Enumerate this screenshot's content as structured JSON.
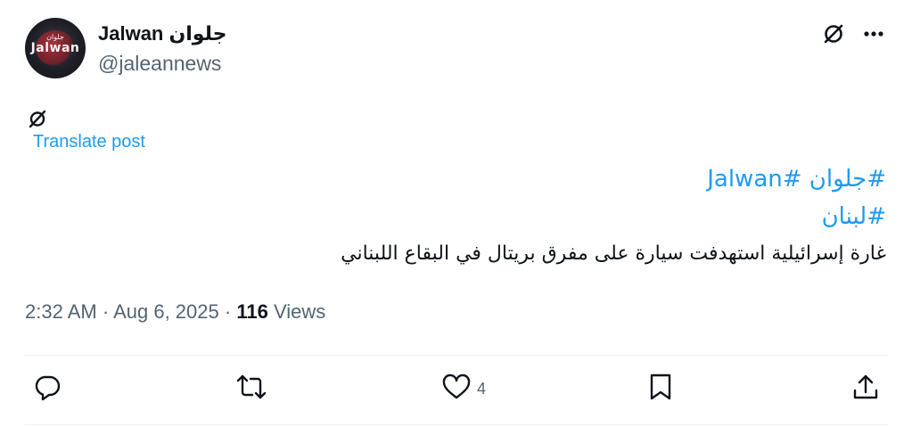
{
  "author": {
    "display_name": "Jalwan جلوان",
    "handle": "@jaleannews",
    "avatar_text": "Jalwan",
    "avatar_subtext": "جلوان"
  },
  "header": {
    "grok_icon": "grok-slash-icon",
    "more_icon": "more-dots-icon"
  },
  "post": {
    "translate_label": "Translate post",
    "hashtag_1": "#جلوان #Jalwan",
    "hashtag_2": "#لبنان",
    "body": "غارة إسرائيلية استهدفت سيارة على مفرق بريتال في البقاع اللبناني"
  },
  "meta": {
    "time": "2:32 AM",
    "separator": "·",
    "date": "Aug 6, 2025",
    "views_count": "116",
    "views_label": "Views"
  },
  "actions": {
    "reply_icon": "reply-icon",
    "retweet_icon": "retweet-icon",
    "like_icon": "heart-icon",
    "like_count": "4",
    "bookmark_icon": "bookmark-icon",
    "share_icon": "share-icon"
  },
  "colors": {
    "link": "#1d9bf0",
    "text": "#0f1419",
    "secondary": "#536471",
    "divider": "#eff3f4"
  }
}
